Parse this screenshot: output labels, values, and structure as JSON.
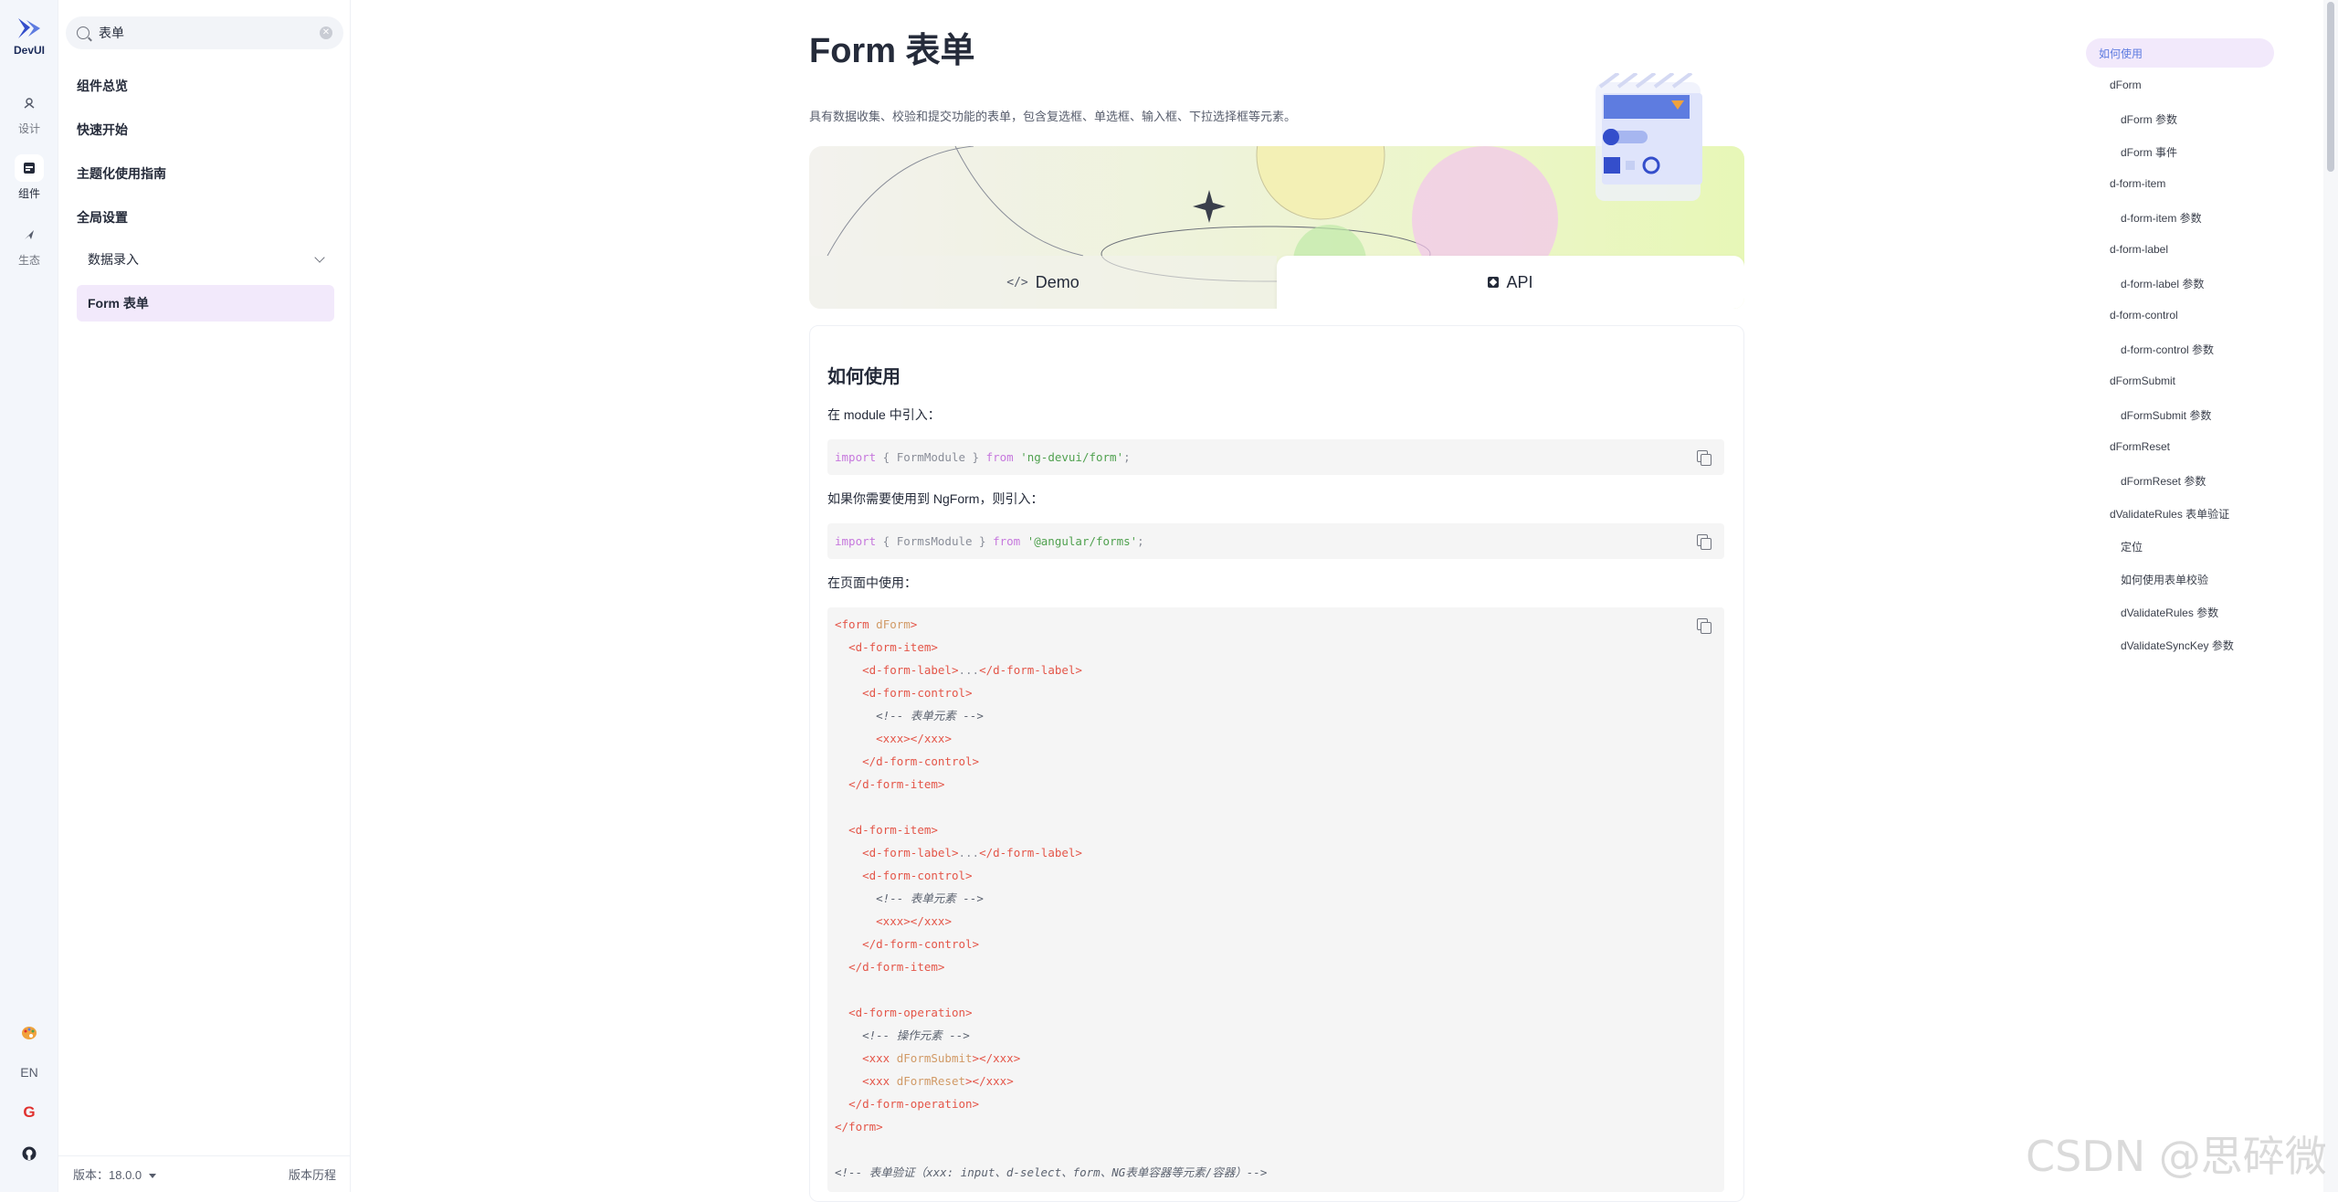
{
  "rail": {
    "logo_text": "DevUI",
    "items": [
      {
        "label": "设计",
        "icon": "design-icon"
      },
      {
        "label": "组件",
        "icon": "component-icon"
      },
      {
        "label": "生态",
        "icon": "ecosystem-icon"
      }
    ],
    "bottom": {
      "theme_icon": "palette-icon",
      "lang": "EN",
      "gitee_icon": "G",
      "github_icon": "github-icon"
    }
  },
  "sidebar": {
    "search_value": "表单",
    "clear_icon": "✕",
    "top_items": [
      "组件总览",
      "快速开始",
      "主题化使用指南",
      "全局设置"
    ],
    "group_label": "数据录入",
    "active_item": "Form 表单",
    "footer": {
      "version": "版本：18.0.0",
      "history": "版本历程"
    }
  },
  "main": {
    "title": "Form 表单",
    "description": "具有数据收集、校验和提交功能的表单，包含复选框、单选框、输入框、下拉选择框等元素。",
    "tabs": {
      "demo": "Demo",
      "demo_icon": "</>",
      "api": "API"
    },
    "section_title": "如何使用",
    "p1": "在 module 中引入：",
    "p2": "如果你需要使用到 NgForm，则引入：",
    "p3": "在页面中使用：",
    "code1": {
      "kw1": "import",
      "body": " { FormModule } ",
      "kw2": "from",
      "str": "'ng-devui/form'",
      "end": ";"
    },
    "code2": {
      "kw1": "import",
      "body": " { FormsModule } ",
      "kw2": "from",
      "str": "'@angular/forms'",
      "end": ";"
    },
    "code3": [
      "<form dForm>",
      "  <d-form-item>",
      "    <d-form-label>...</d-form-label>",
      "    <d-form-control>",
      "      <!-- 表单元素 -->",
      "      <xxx></xxx>",
      "    </d-form-control>",
      "  </d-form-item>",
      "",
      "  <d-form-item>",
      "    <d-form-label>...</d-form-label>",
      "    <d-form-control>",
      "      <!-- 表单元素 -->",
      "      <xxx></xxx>",
      "    </d-form-control>",
      "  </d-form-item>",
      "",
      "  <d-form-operation>",
      "    <!-- 操作元素 -->",
      "    <xxx dFormSubmit></xxx>",
      "    <xxx dFormReset></xxx>",
      "  </d-form-operation>",
      "</form>",
      "",
      "<!-- 表单验证（xxx: input、d-select、form、NG表单容器等元素/容器）-->"
    ]
  },
  "toc": {
    "active": "如何使用",
    "items": [
      {
        "label": "dForm",
        "level": 1
      },
      {
        "label": "dForm 参数",
        "level": 2
      },
      {
        "label": "dForm 事件",
        "level": 2
      },
      {
        "label": "d-form-item",
        "level": 1
      },
      {
        "label": "d-form-item 参数",
        "level": 2
      },
      {
        "label": "d-form-label",
        "level": 1
      },
      {
        "label": "d-form-label 参数",
        "level": 2
      },
      {
        "label": "d-form-control",
        "level": 1
      },
      {
        "label": "d-form-control 参数",
        "level": 2
      },
      {
        "label": "dFormSubmit",
        "level": 1
      },
      {
        "label": "dFormSubmit 参数",
        "level": 2
      },
      {
        "label": "dFormReset",
        "level": 1
      },
      {
        "label": "dFormReset 参数",
        "level": 2
      },
      {
        "label": "dValidateRules 表单验证",
        "level": 1
      },
      {
        "label": "定位",
        "level": 2
      },
      {
        "label": "如何使用表单校验",
        "level": 2
      },
      {
        "label": "dValidateRules 参数",
        "level": 2
      },
      {
        "label": "dValidateSyncKey 参数",
        "level": 2
      }
    ]
  },
  "watermark": "CSDN @思碎微",
  "colors": {
    "accent": "#5e7ce0",
    "active_bg": "#f2e9fb"
  }
}
